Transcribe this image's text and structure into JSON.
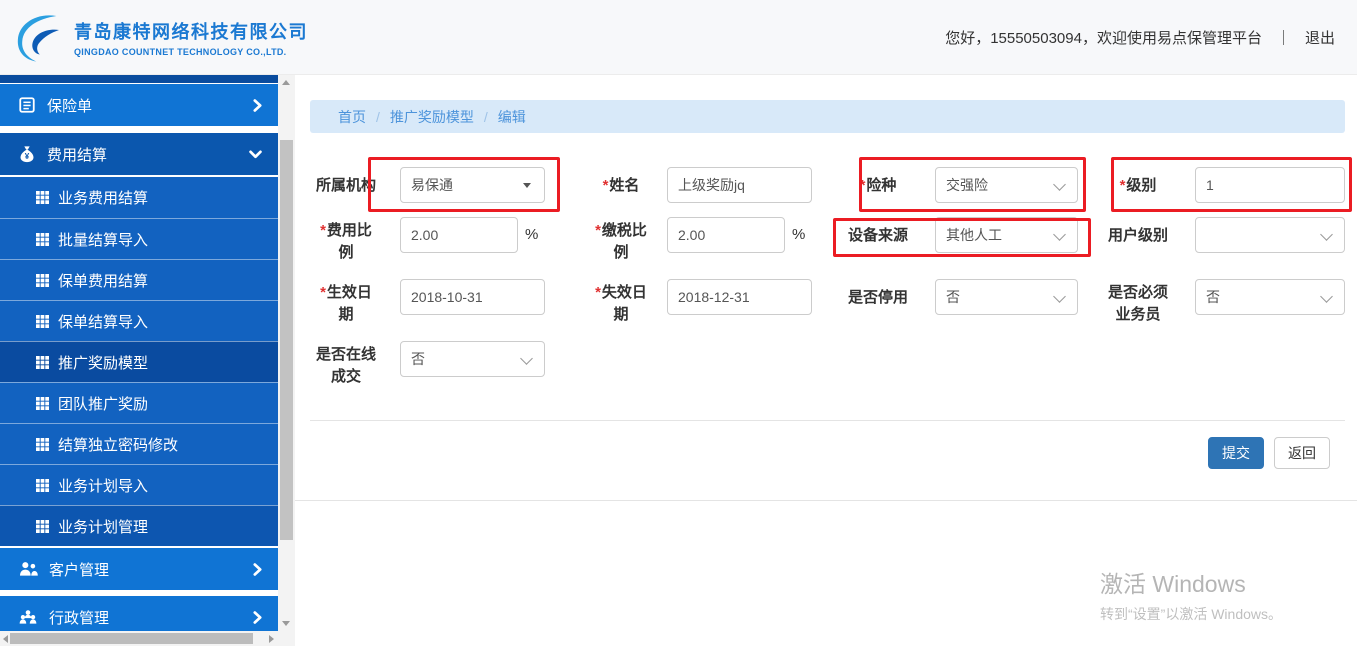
{
  "header": {
    "company_name_cn": "青岛康特网络科技有限公司",
    "company_name_en": "QINGDAO COUNTNET TECHNOLOGY CO.,LTD.",
    "welcome_text": "您好，15550503094，欢迎使用易点保管理平台",
    "divider": "｜",
    "logout_label": "退出"
  },
  "sidebar": {
    "items": [
      {
        "id": "insurance-policy",
        "label": "保险单",
        "icon": "document-icon",
        "expanded": false
      },
      {
        "id": "fee-settlement",
        "label": "费用结算",
        "icon": "money-bag-icon",
        "expanded": true,
        "children": [
          {
            "id": "biz-fee-settlement",
            "label": "业务费用结算",
            "active": false
          },
          {
            "id": "batch-settlement-import",
            "label": "批量结算导入",
            "active": false
          },
          {
            "id": "policy-fee-settlement",
            "label": "保单费用结算",
            "active": false
          },
          {
            "id": "policy-settlement-import",
            "label": "保单结算导入",
            "active": false
          },
          {
            "id": "promo-reward-model",
            "label": "推广奖励模型",
            "active": true
          },
          {
            "id": "team-promo-reward",
            "label": "团队推广奖励",
            "active": false
          },
          {
            "id": "settlement-password-change",
            "label": "结算独立密码修改",
            "active": false
          },
          {
            "id": "biz-plan-import",
            "label": "业务计划导入",
            "active": false
          },
          {
            "id": "biz-plan-manage",
            "label": "业务计划管理",
            "active": false,
            "hovered": true
          }
        ]
      },
      {
        "id": "customer-management",
        "label": "客户管理",
        "icon": "customers-icon",
        "expanded": false
      },
      {
        "id": "admin-management",
        "label": "行政管理",
        "icon": "admin-group-icon",
        "expanded": false
      }
    ]
  },
  "breadcrumb": {
    "separator": "/",
    "items": [
      {
        "label": "首页"
      },
      {
        "label": "推广奖励模型"
      },
      {
        "label": "编辑"
      }
    ]
  },
  "form": {
    "required_marker": "*",
    "fields": {
      "org": {
        "label": "所属机构",
        "required": false,
        "control": "select",
        "value": "易保通"
      },
      "name": {
        "label": "姓名",
        "required": true,
        "control": "input",
        "value": "上级奖励jq"
      },
      "insurance_type": {
        "label": "险种",
        "required": true,
        "control": "select",
        "value": "交强险"
      },
      "level": {
        "label": "级别",
        "required": true,
        "control": "input",
        "value": "1"
      },
      "fee_ratio": {
        "label": "费用比\n例",
        "required": true,
        "control": "input",
        "value": "2.00",
        "suffix": "%"
      },
      "tax_ratio": {
        "label": "缴税比\n例",
        "required": true,
        "control": "input",
        "value": "2.00",
        "suffix": "%"
      },
      "device_source": {
        "label": "设备来源",
        "required": false,
        "control": "select",
        "value": "其他人工"
      },
      "user_level": {
        "label": "用户级别",
        "required": false,
        "control": "select",
        "value": ""
      },
      "effective_date": {
        "label": "生效日\n期",
        "required": true,
        "control": "input",
        "value": "2018-10-31"
      },
      "expire_date": {
        "label": "失效日\n期",
        "required": true,
        "control": "input",
        "value": "2018-12-31"
      },
      "is_disabled": {
        "label": "是否停用",
        "required": false,
        "control": "select",
        "value": "否"
      },
      "require_salesman": {
        "label": "是否必须\n业务员",
        "required": false,
        "control": "select",
        "value": "否"
      },
      "online_deal": {
        "label": "是否在线\n成交",
        "required": false,
        "control": "select",
        "value": "否"
      }
    },
    "buttons": {
      "submit": "提交",
      "back": "返回"
    }
  },
  "annotations": {
    "highlighted_fields": [
      "所属机构",
      "险种",
      "级别",
      "设备来源"
    ]
  },
  "watermark": {
    "line1": "激活 Windows",
    "line2": "转到“设置”以激活 Windows。"
  },
  "colors": {
    "sidebar_bright": "#1074d4",
    "sidebar_expanded": "#0b57ae",
    "sidebar_sub": "#1262c0",
    "sidebar_active": "#0a4ba0",
    "breadcrumb_bg": "#d8e9f9",
    "link_blue": "#4d94db",
    "brand_blue": "#1b79d2",
    "annotation_red": "#eb1c23",
    "submit_blue": "#2e74b5",
    "required_red": "#e03131"
  }
}
